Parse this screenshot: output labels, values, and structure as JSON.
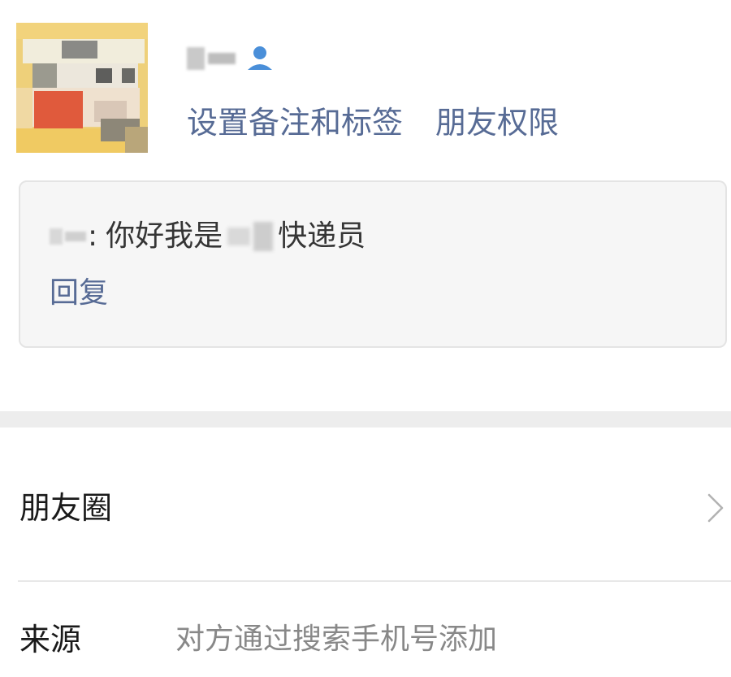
{
  "profile": {
    "avatar_icon": "pixelated-avatar",
    "contact_icon": "person-icon",
    "links": {
      "remark_tags": "设置备注和标签",
      "friend_permissions": "朋友权限"
    }
  },
  "greeting": {
    "separator": ":",
    "text_before": "你好我是",
    "text_after": "快递员",
    "reply_label": "回复"
  },
  "moments": {
    "label": "朋友圈",
    "chevron_icon": "chevron-right-icon"
  },
  "source": {
    "label": "来源",
    "value": "对方通过搜索手机号添加"
  },
  "colors": {
    "link": "#576b95",
    "icon_blue": "#4a8fd9",
    "card_bg": "#f6f6f6",
    "band_bg": "#ededed",
    "secondary_text": "#888888"
  }
}
